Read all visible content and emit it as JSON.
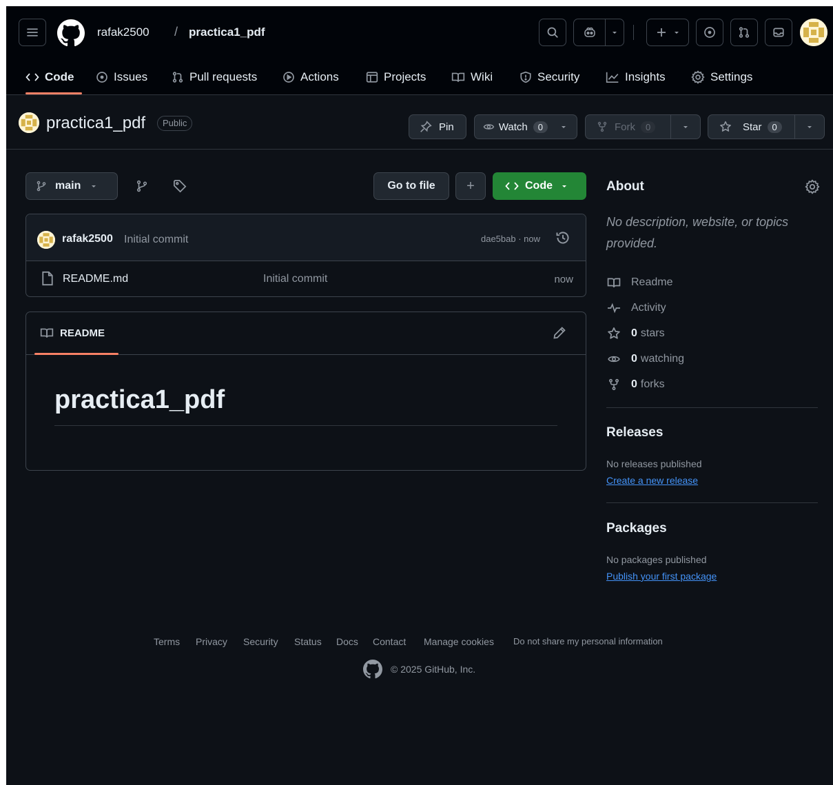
{
  "header": {
    "owner": "rafak2500",
    "separator": "/",
    "repo": "practica1_pdf"
  },
  "repo_tabs": [
    {
      "label": "Code",
      "icon": "code-icon"
    },
    {
      "label": "Issues",
      "icon": "issue-icon"
    },
    {
      "label": "Pull requests",
      "icon": "pull-request-icon"
    },
    {
      "label": "Actions",
      "icon": "play-icon"
    },
    {
      "label": "Projects",
      "icon": "table-icon"
    },
    {
      "label": "Wiki",
      "icon": "book-icon"
    },
    {
      "label": "Security",
      "icon": "shield-icon"
    },
    {
      "label": "Insights",
      "icon": "graph-icon"
    },
    {
      "label": "Settings",
      "icon": "gear-icon"
    }
  ],
  "title_row": {
    "name": "practica1_pdf",
    "visibility": "Public",
    "pin_label": "Pin",
    "watch_label": "Watch",
    "watch_count": "0",
    "fork_label": "Fork",
    "fork_count": "0",
    "star_label": "Star",
    "star_count": "0"
  },
  "toolbar": {
    "branch": "main",
    "go_to_file": "Go to file",
    "add": "+",
    "code": "Code"
  },
  "commit": {
    "author": "rafak2500",
    "message": "Initial commit",
    "meta": "dae5bab · now"
  },
  "files": [
    {
      "name": "README.md",
      "commit": "Initial commit",
      "time": "now"
    }
  ],
  "readme": {
    "tab": "README",
    "heading": "practica1_pdf"
  },
  "about": {
    "title": "About",
    "description": "No description, website, or topics provided.",
    "items": [
      {
        "icon": "book-icon",
        "count": "",
        "label": "Readme"
      },
      {
        "icon": "pulse-icon",
        "count": "",
        "label": "Activity"
      },
      {
        "icon": "star-icon",
        "count": "0",
        "label": "stars"
      },
      {
        "icon": "eye-icon",
        "count": "0",
        "label": "watching"
      },
      {
        "icon": "fork-icon",
        "count": "0",
        "label": "forks"
      }
    ]
  },
  "releases": {
    "title": "Releases",
    "empty": "No releases published",
    "link": "Create a new release"
  },
  "packages": {
    "title": "Packages",
    "empty": "No packages published",
    "link": "Publish your first package"
  },
  "footer": {
    "links": [
      "Terms",
      "Privacy",
      "Security",
      "Status",
      "Docs",
      "Contact",
      "Manage cookies",
      "Do not share my personal information"
    ],
    "copyright": "© 2025 GitHub, Inc."
  },
  "colors": {
    "background": "#0d1117",
    "header": "#010409",
    "accent_green": "#238636",
    "tab_underline": "#f78166",
    "link": "#4493f8"
  }
}
